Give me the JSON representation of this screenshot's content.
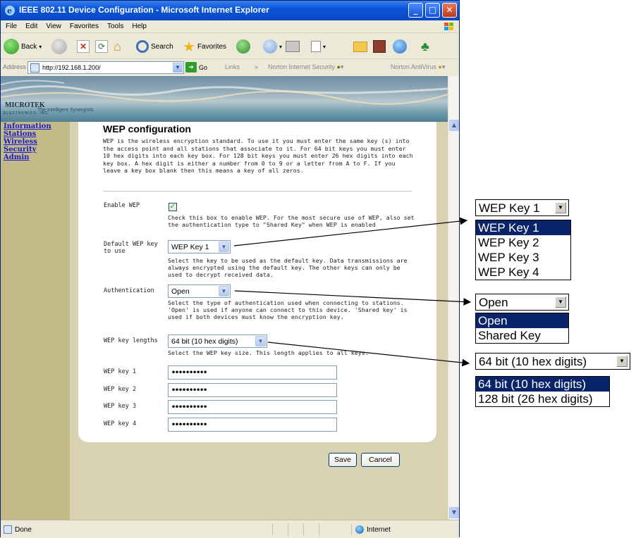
{
  "window": {
    "title": "IEEE 802.11 Device Configuration - Microsoft Internet Explorer",
    "controls": [
      "_",
      "□",
      "✕"
    ]
  },
  "menu": [
    "File",
    "Edit",
    "View",
    "Favorites",
    "Tools",
    "Help"
  ],
  "toolbar": {
    "back": "Back",
    "search": "Search",
    "favorites": "Favorites"
  },
  "address": {
    "label": "Address",
    "url": "http://192.168.1.200/",
    "go": "Go",
    "links": "Links",
    "norton": "Norton Internet Security",
    "norton_av": "Norton AntiVirus"
  },
  "banner": {
    "logo": "MICROTEK",
    "logo_sub": "ELECTRONICS, INC.",
    "tagline": "The Intelligent Synergistic"
  },
  "sidebar": [
    {
      "label": "Information"
    },
    {
      "label": "Stations"
    },
    {
      "label": "Wireless"
    },
    {
      "label": "Security"
    },
    {
      "label": "Admin"
    }
  ],
  "page": {
    "heading": "WEP configuration",
    "description": "WEP is the wireless encryption standard. To use it you must enter the same key (s) into the access point and all stations that associate to it. For 64 bit keys you must enter 10 hex digits into each key box. For 128 bit keys you must enter 26 hex digits into each key box. A hex digit is either a number from 0 to 9 or a letter from A to F. If you leave a key box blank then this means a key of all zeros.",
    "enable_wep": {
      "label": "Enable WEP",
      "checked": true,
      "check_glyph": "✓",
      "help": "Check this box to enable WEP. For the most secure use of WEP, also set the authentication type to \"Shared Key\" when WEP is enabled"
    },
    "default_key": {
      "label": "Default WEP key to use",
      "value": "WEP Key 1",
      "help": "Select the key to be used as the default key. Data transmissions are always encrypted using the default key. The other keys can only be used to decrypt received data."
    },
    "authentication": {
      "label": "Authentication",
      "value": "Open",
      "help": "Select the type of authentication used when connecting to stations. 'Open' is used if anyone can connect to this device. 'Shared key' is used if both devices must know the encryption key."
    },
    "key_lengths": {
      "label": "WEP key lengths",
      "value": "64 bit (10 hex digits)",
      "help": "Select the WEP key size. This length applies to all keys."
    },
    "keys": [
      {
        "label": "WEP key 1",
        "value": "••••••••••"
      },
      {
        "label": "WEP key 2",
        "value": "••••••••••"
      },
      {
        "label": "WEP key 3",
        "value": "••••••••••"
      },
      {
        "label": "WEP key 4",
        "value": "••••••••••"
      }
    ],
    "save": "Save",
    "cancel": "Cancel"
  },
  "status": {
    "text": "Done",
    "zone": "Internet"
  },
  "callouts": {
    "default_key": {
      "value": "WEP Key 1",
      "options": [
        "WEP Key 1",
        "WEP Key 2",
        "WEP Key 3",
        "WEP Key 4"
      ]
    },
    "authentication": {
      "value": "Open",
      "options": [
        "Open",
        "Shared Key"
      ]
    },
    "key_lengths": {
      "value": "64 bit (10 hex digits)",
      "options": [
        "64 bit (10 hex digits)",
        "128 bit (26 hex digits)"
      ]
    }
  },
  "colors": {
    "titlebar": "#0a55d8",
    "sidebar": "#c3bb87",
    "content_bg": "#d8d2b0",
    "selected_option": "#0a246a",
    "nav_link": "#1a1ad0"
  }
}
